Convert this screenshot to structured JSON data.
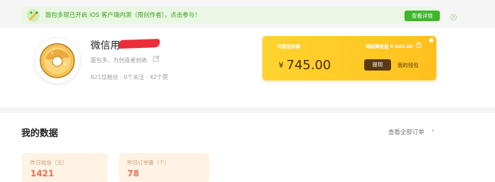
{
  "banner": {
    "text": "面包多现已开启 iOS 客户端内测（限创作者），点击参与！",
    "button_label": "查看详情",
    "close_glyph": "×"
  },
  "profile": {
    "username_visible": "微信用",
    "intro": "面包多，为创造者创收",
    "stats": "621位粉丝 · 0个关注 · 42个赞"
  },
  "wallet": {
    "label": "可提现余额",
    "pending": "待结算收益 ¥ 645.00",
    "help_glyph": "?",
    "currency": "¥",
    "amount": "745.00",
    "withdraw_label": "提现",
    "my_wallet_label": "我的钱包"
  },
  "data_section": {
    "title": "我的数据",
    "all_orders_label": "查看全部订单",
    "chevron_glyph": "›",
    "cards": [
      {
        "label": "昨日收益（元）",
        "value": "1421"
      },
      {
        "label": "昨日订单量（个）",
        "value": "78"
      }
    ]
  },
  "colors": {
    "accent_green": "#3fb52b",
    "wallet_yellow": "#ffc724",
    "stat_orange": "#f36d4e",
    "redaction_red": "#ec2e3c"
  },
  "icons": [
    "gift-icon",
    "donut-avatar-icon",
    "edit-icon",
    "help-icon",
    "chevron-right-icon",
    "close-icon"
  ]
}
